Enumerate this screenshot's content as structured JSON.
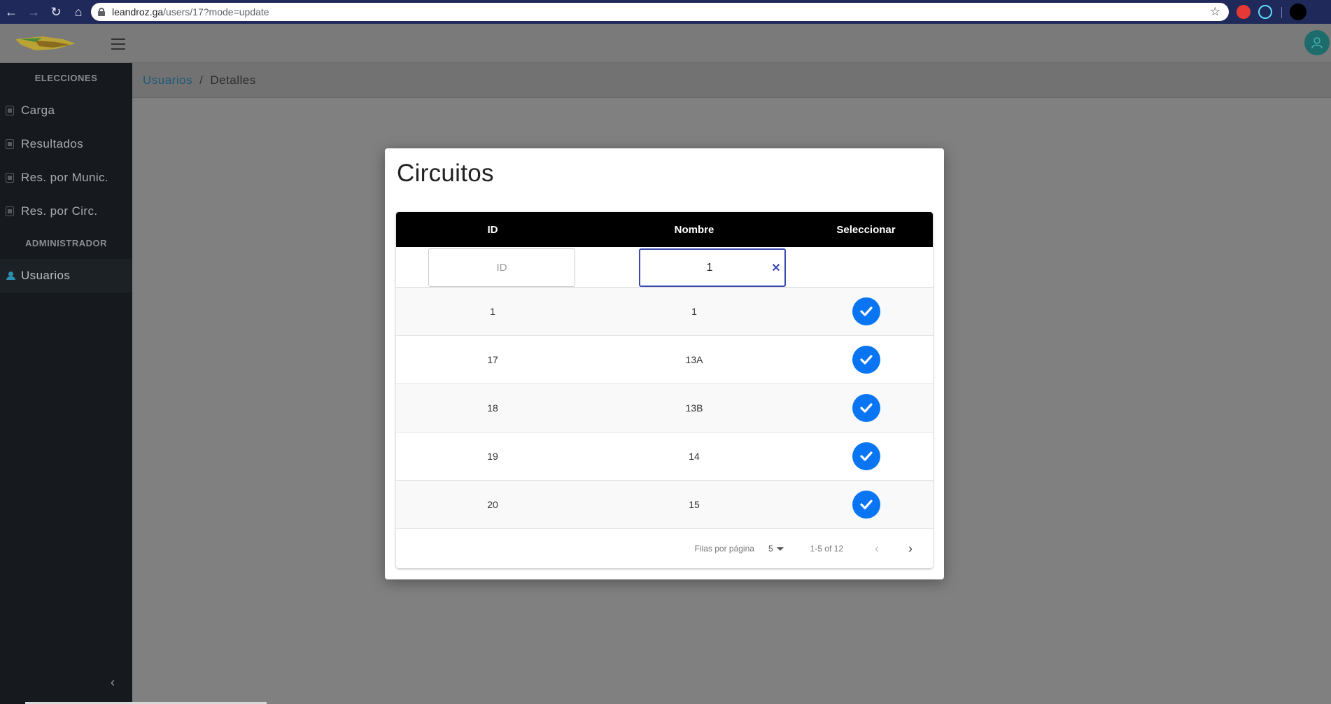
{
  "browser": {
    "url_host": "leandroz.ga",
    "url_path": "/users/17?mode=update"
  },
  "sidebar": {
    "section_elecciones": "ELECCIONES",
    "items_elecciones": [
      {
        "label": "Carga"
      },
      {
        "label": "Resultados"
      },
      {
        "label": "Res. por Munic."
      },
      {
        "label": "Res. por Circ."
      }
    ],
    "section_admin": "ADMINISTRADOR",
    "item_usuarios": "Usuarios"
  },
  "breadcrumb": {
    "link": "Usuarios",
    "separator": "/",
    "current": "Detalles"
  },
  "modal": {
    "title": "Circuitos",
    "columns": [
      "ID",
      "Nombre",
      "Seleccionar"
    ],
    "filters": {
      "id_placeholder": "ID",
      "name_value": "1"
    },
    "rows": [
      {
        "id": "1",
        "nombre": "1"
      },
      {
        "id": "17",
        "nombre": "13A"
      },
      {
        "id": "18",
        "nombre": "13B"
      },
      {
        "id": "19",
        "nombre": "14"
      },
      {
        "id": "20",
        "nombre": "15"
      }
    ],
    "footer": {
      "rows_per_page_label": "Filas por página",
      "rows_per_page_value": "5",
      "range": "1-5 of 12"
    }
  },
  "colors": {
    "accent_button": "#0a75f2",
    "header_row": "#000000",
    "sidebar_bg": "#161a1e"
  }
}
